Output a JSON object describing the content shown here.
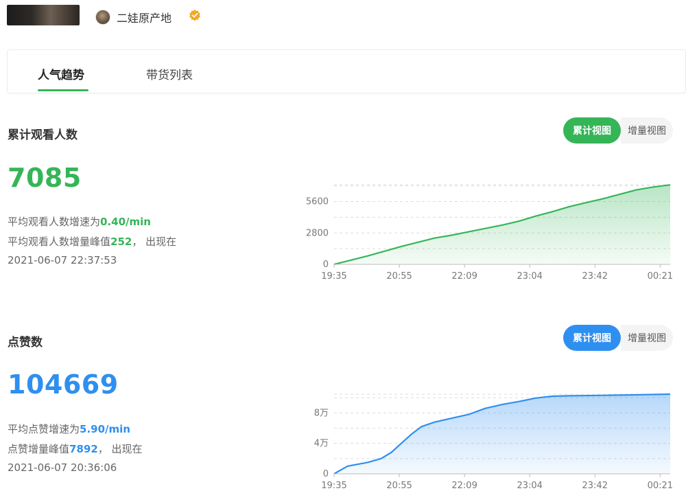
{
  "header": {
    "account_name": "二娃原产地",
    "icons": {
      "avatar": "avatar",
      "verified": "verified-badge-icon"
    }
  },
  "tabs": [
    {
      "label": "人气趋势",
      "active": true
    },
    {
      "label": "带货列表",
      "active": false
    }
  ],
  "colors": {
    "accent_green": "#35b558",
    "accent_blue": "#2f8ff0"
  },
  "viewers": {
    "title": "累计观看人数",
    "total": "7085",
    "avg_speed_prefix": "平均观看人数增速为",
    "avg_speed_value": "0.40/min",
    "peak_prefix": "平均观看人数增量峰值",
    "peak_value": "252",
    "peak_suffix": "， 出现在",
    "peak_time": "2021-06-07 22:37:53",
    "toggle_active": "累计视图",
    "toggle_inactive": "增量视图"
  },
  "likes": {
    "title": "点赞数",
    "total": "104669",
    "avg_speed_prefix": "平均点赞增速为",
    "avg_speed_value": "5.90/min",
    "peak_prefix": "点赞增量峰值",
    "peak_value": "7892",
    "peak_suffix": "， 出现在",
    "peak_time": "2021-06-07 20:36:06",
    "toggle_active": "累计视图",
    "toggle_inactive": "增量视图"
  },
  "chart_data": [
    {
      "type": "area",
      "x_ticks": [
        "19:35",
        "20:55",
        "22:09",
        "23:04",
        "23:42",
        "00:21"
      ],
      "y_ticks": [
        {
          "value": 0,
          "label": "0"
        },
        {
          "value": 2800,
          "label": "2800"
        },
        {
          "value": 5600,
          "label": "5600"
        }
      ],
      "ylim": [
        0,
        7100
      ],
      "grid": true,
      "color": "#35b558",
      "x": [
        0,
        0.1,
        0.2,
        0.3,
        0.35,
        0.4,
        0.5,
        0.55,
        0.6,
        0.65,
        0.7,
        0.75,
        0.8,
        0.85,
        0.9,
        0.95,
        1.0
      ],
      "values": [
        0,
        750,
        1600,
        2350,
        2600,
        2900,
        3500,
        3850,
        4300,
        4700,
        5150,
        5500,
        5850,
        6250,
        6650,
        6900,
        7085
      ]
    },
    {
      "type": "area",
      "x_ticks": [
        "19:35",
        "20:55",
        "22:09",
        "23:04",
        "23:42",
        "00:21"
      ],
      "y_ticks": [
        {
          "value": 0,
          "label": "0"
        },
        {
          "value": 40000,
          "label": "4万"
        },
        {
          "value": 80000,
          "label": "8万"
        }
      ],
      "ylim": [
        0,
        104669
      ],
      "grid": true,
      "color": "#2f8ff0",
      "x": [
        0,
        0.04,
        0.1,
        0.14,
        0.17,
        0.2,
        0.23,
        0.26,
        0.3,
        0.35,
        0.4,
        0.45,
        0.5,
        0.55,
        0.6,
        0.65,
        0.7,
        0.8,
        0.9,
        1.0
      ],
      "values": [
        0,
        10000,
        15000,
        20000,
        28000,
        40000,
        52000,
        62000,
        68000,
        73000,
        78000,
        86000,
        91000,
        95000,
        99500,
        102000,
        102500,
        103000,
        103800,
        104669
      ]
    }
  ]
}
